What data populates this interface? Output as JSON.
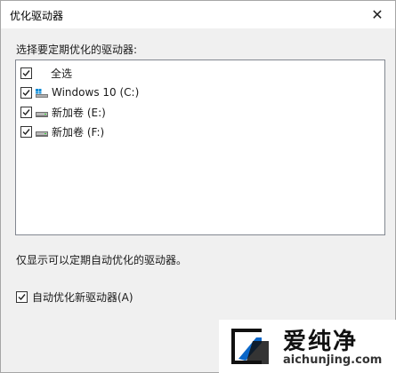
{
  "window": {
    "title": "优化驱动器",
    "close_glyph": "✕"
  },
  "section_label": "选择要定期优化的驱动器:",
  "drives": [
    {
      "label": "全选",
      "checked": true,
      "icon": "none"
    },
    {
      "label": "Windows 10 (C:)",
      "checked": true,
      "icon": "windows-drive-icon"
    },
    {
      "label": "新加卷 (E:)",
      "checked": true,
      "icon": "drive-icon"
    },
    {
      "label": "新加卷 (F:)",
      "checked": true,
      "icon": "drive-icon"
    }
  ],
  "note": "仅显示可以定期自动优化的驱动器。",
  "auto_option": {
    "label": "自动优化新驱动器(A)",
    "checked": true
  },
  "watermark": {
    "text": "爱纯净",
    "url": "aichunjing.com"
  },
  "colors": {
    "accent": "#0078d7",
    "list_border": "#828790",
    "dialog_bg": "#f0f0f0"
  }
}
